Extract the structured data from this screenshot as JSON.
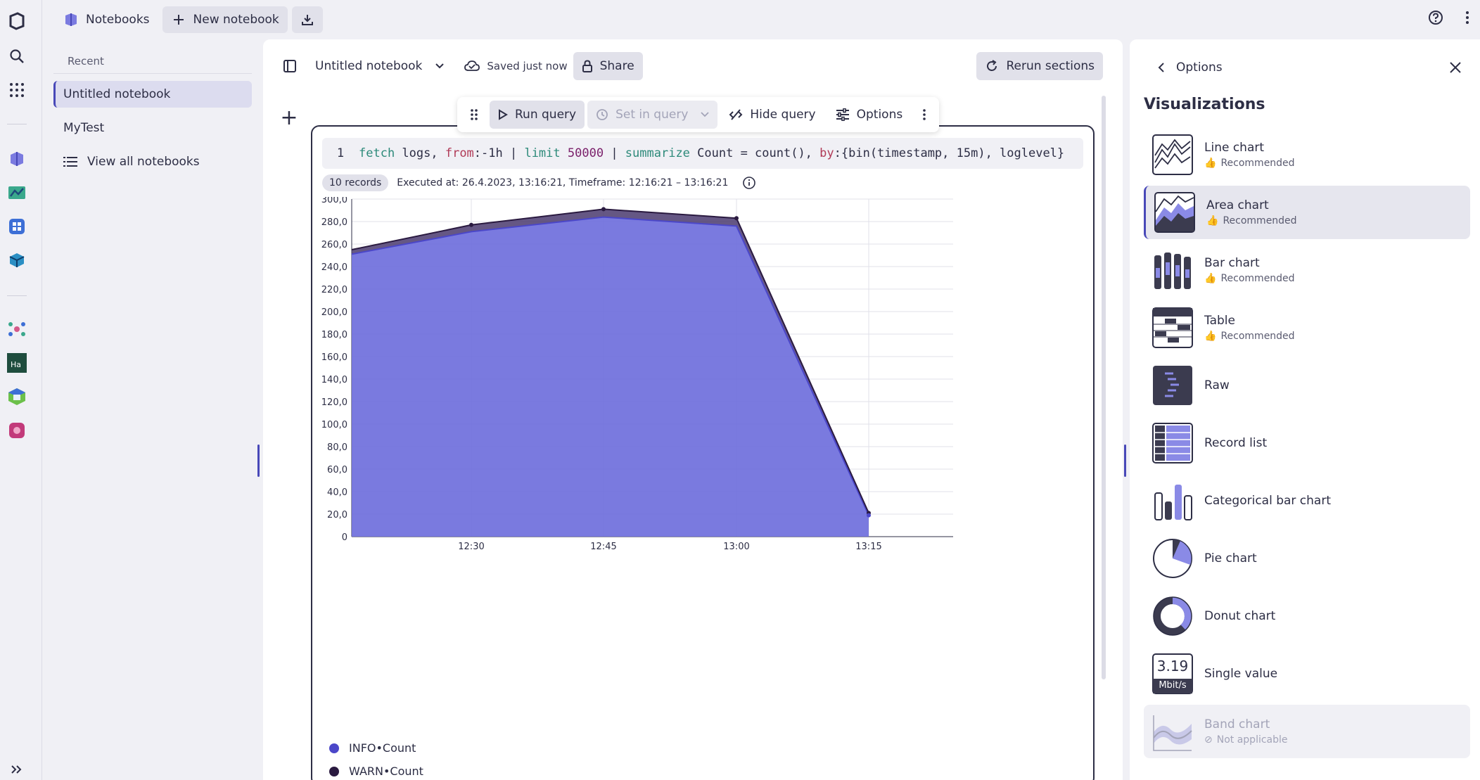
{
  "topbar": {
    "app_name": "Notebooks",
    "new_notebook_label": "New notebook"
  },
  "leftpanel": {
    "recent_heading": "Recent",
    "items": [
      "Untitled notebook",
      "MyTest"
    ],
    "view_all_label": "View all notebooks"
  },
  "notebook": {
    "title": "Untitled notebook",
    "save_status": "Saved just now",
    "share_label": "Share",
    "rerun_label": "Rerun sections"
  },
  "section_toolbar": {
    "run_label": "Run query",
    "set_label": "Set in query",
    "hide_label": "Hide query",
    "options_label": "Options"
  },
  "query": {
    "line_number": "1",
    "tokens": {
      "fetch": "fetch",
      "logs": " logs, ",
      "from": "from",
      "from_val": ":-1h | ",
      "limit": "limit",
      "limit_val": "50000",
      "sep2": " | ",
      "summarize": "summarize",
      "rest1": " Count = count(), ",
      "by": "by",
      "rest2": ":{bin(timestamp, 15m), loglevel}"
    }
  },
  "result": {
    "records_badge": "10 records",
    "executed_text": "Executed at: 26.4.2023, 13:16:21, Timeframe: 12:16:21 – 13:16:21"
  },
  "chart_data": {
    "type": "area",
    "stacked": true,
    "x": [
      "12:20",
      "12:30",
      "12:45",
      "13:00",
      "13:15"
    ],
    "x_ticks": [
      "12:30",
      "12:45",
      "13:00",
      "13:15"
    ],
    "y_ticks": [
      "0",
      "20,0",
      "40,0",
      "60,0",
      "80,0",
      "100,0",
      "120,0",
      "140,0",
      "160,0",
      "180,0",
      "200,0",
      "220,0",
      "240,0",
      "260,0",
      "280,0",
      "300,0"
    ],
    "ylim": [
      0,
      300
    ],
    "grid": true,
    "legend_position": "bottom-left",
    "series": [
      {
        "name": "INFO•Count",
        "color": "#6f6fdc",
        "values": [
          251,
          271,
          284,
          276,
          19
        ]
      },
      {
        "name": "WARN•Count",
        "color": "#3b2b5c",
        "values": [
          4,
          6,
          7,
          7,
          2
        ]
      }
    ]
  },
  "rightpanel": {
    "back_label": "Options",
    "title": "Visualizations",
    "items": [
      {
        "name": "Line chart",
        "sub": "Recommended"
      },
      {
        "name": "Area chart",
        "sub": "Recommended"
      },
      {
        "name": "Bar chart",
        "sub": "Recommended"
      },
      {
        "name": "Table",
        "sub": "Recommended"
      },
      {
        "name": "Raw",
        "sub": ""
      },
      {
        "name": "Record list",
        "sub": ""
      },
      {
        "name": "Categorical bar chart",
        "sub": ""
      },
      {
        "name": "Pie chart",
        "sub": ""
      },
      {
        "name": "Donut chart",
        "sub": ""
      },
      {
        "name": "Single value",
        "sub": ""
      },
      {
        "name": "Band chart",
        "sub": "Not applicable"
      }
    ],
    "single_value_thumb": {
      "value": "3.19",
      "unit": "Mbit/s"
    }
  }
}
